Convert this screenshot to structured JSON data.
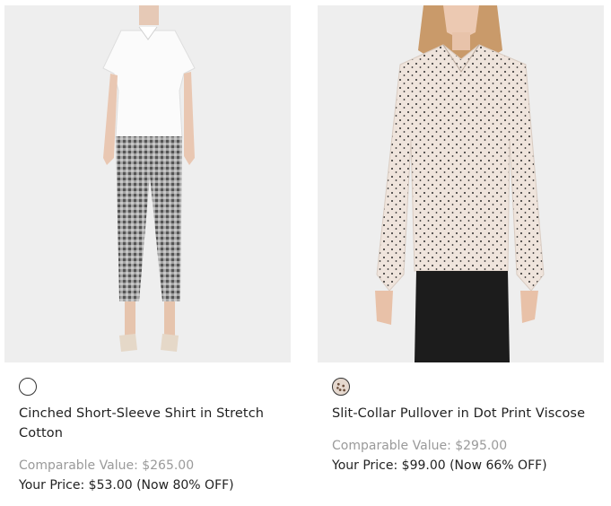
{
  "products": [
    {
      "name": "Cinched Short-Sleeve Shirt in Stretch Cotton",
      "comparable": "Comparable Value: $265.00",
      "price": "Your Price: $53.00 (Now 80% OFF)",
      "swatch_color": "#ffffff"
    },
    {
      "name": "Slit-Collar Pullover in Dot Print Viscose",
      "comparable": "Comparable Value: $295.00",
      "price": "Your Price: $99.00 (Now 66% OFF)",
      "swatch_color": "#e6d9cf"
    }
  ]
}
